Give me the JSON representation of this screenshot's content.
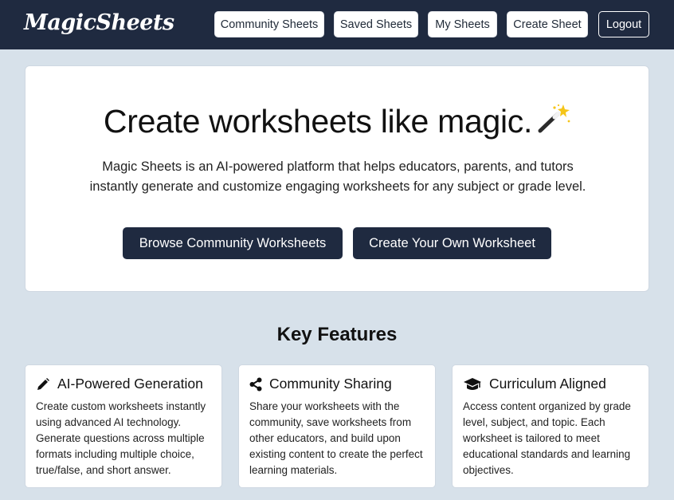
{
  "navbar": {
    "logo": "MagicSheets",
    "items": [
      {
        "label": "Community Sheets"
      },
      {
        "label": "Saved Sheets"
      },
      {
        "label": "My Sheets"
      },
      {
        "label": "Create Sheet"
      }
    ],
    "logout_label": "Logout"
  },
  "hero": {
    "title": "Create worksheets like magic.",
    "title_icon": "magic-wand-icon",
    "description": "Magic Sheets is an AI-powered platform that helps educators, parents, and tutors instantly generate and customize engaging worksheets for any subject or grade level.",
    "browse_button": "Browse Community Worksheets",
    "create_button": "Create Your Own Worksheet"
  },
  "features": {
    "heading": "Key Features",
    "cards": [
      {
        "icon": "pencil-icon",
        "title": "AI-Powered Generation",
        "body": "Create custom worksheets instantly using advanced AI technology. Generate questions across multiple formats including multiple choice, true/false, and short answer."
      },
      {
        "icon": "share-icon",
        "title": "Community Sharing",
        "body": "Share your worksheets with the community, save worksheets from other educators, and build upon existing content to create the perfect learning materials."
      },
      {
        "icon": "graduation-cap-icon",
        "title": "Curriculum Aligned",
        "body": "Access content organized by grade level, subject, and topic. Each worksheet is tailored to meet educational standards and learning objectives."
      }
    ]
  },
  "colors": {
    "navbar_bg": "#1f2a40",
    "page_bg": "#d7e1ea",
    "button_dark": "#1f2a40",
    "card_bg": "#ffffff"
  }
}
